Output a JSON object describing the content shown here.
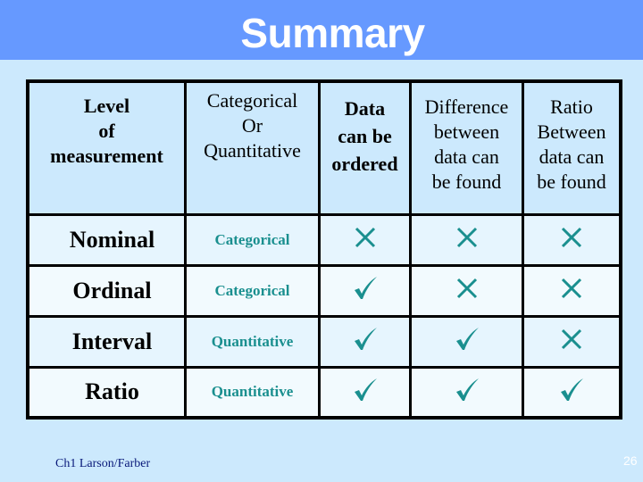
{
  "slide": {
    "title": "Summary",
    "footer": "Ch1 Larson/Farber",
    "page_number": "26",
    "colors": {
      "title_bar": "#6699ff",
      "background": "#cce9fd",
      "mark": "#1a8f8f",
      "footer_text": "#0a1a7a"
    }
  },
  "table": {
    "headers": [
      {
        "lines": [
          "Level",
          "of",
          "measurement"
        ]
      },
      {
        "lines": [
          "Categorical",
          "Or",
          "Quantitative"
        ]
      },
      {
        "lines": [
          "Data",
          "can be",
          "ordered"
        ]
      },
      {
        "lines": [
          "Difference",
          "between",
          "data can",
          "be found"
        ]
      },
      {
        "lines": [
          "Ratio",
          "Between",
          "data can",
          "be found"
        ]
      }
    ],
    "rows": [
      {
        "level": "Nominal",
        "kind": "Categorical",
        "ordered": "cross-icon",
        "difference": "cross-icon",
        "ratio": "cross-icon"
      },
      {
        "level": "Ordinal",
        "kind": "Categorical",
        "ordered": "check-icon",
        "difference": "cross-icon",
        "ratio": "cross-icon"
      },
      {
        "level": "Interval",
        "kind": "Quantitative",
        "ordered": "check-icon",
        "difference": "check-icon",
        "ratio": "cross-icon"
      },
      {
        "level": "Ratio",
        "kind": "Quantitative",
        "ordered": "check-icon",
        "difference": "check-icon",
        "ratio": "check-icon"
      }
    ]
  }
}
